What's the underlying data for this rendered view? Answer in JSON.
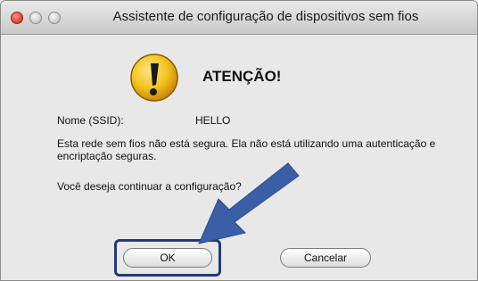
{
  "window": {
    "title": "Assistente de configuração de dispositivos sem fios"
  },
  "dialog": {
    "heading": "ATENÇÃO!",
    "ssid_label": "Nome (SSID):",
    "ssid_value": "HELLO",
    "message": "Esta rede sem fios não está segura. Ela não está utilizando uma autenticação e encriptação seguras.",
    "question": "Você deseja continuar a configuração?",
    "icon": "warning-exclamation-icon"
  },
  "buttons": {
    "ok_label": "OK",
    "cancel_label": "Cancelar"
  },
  "colors": {
    "arrow": "#3a5fa6",
    "highlight_border": "#233a73",
    "warning_fill": "#f2c21e"
  }
}
